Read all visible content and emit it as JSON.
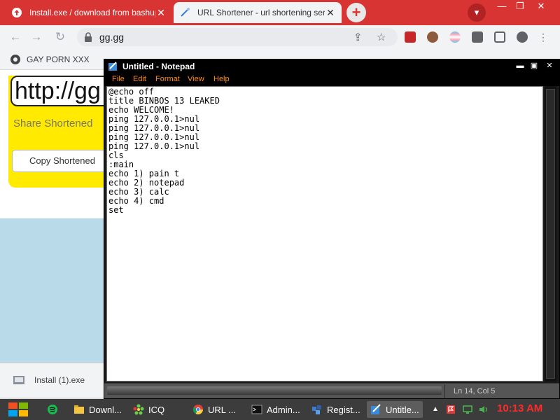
{
  "browser": {
    "tabs": [
      {
        "title": "Install.exe / download from bashupl",
        "icon": "upload-icon",
        "active": false
      },
      {
        "title": "URL Shortener - url shortening serv",
        "icon": "link-icon",
        "active": true
      }
    ],
    "address": "gg.gg",
    "accent_color": "#d83434",
    "bookmarks": [
      {
        "label": "GAY PORN XXX",
        "icon": "puzzle-icon"
      }
    ]
  },
  "webpage": {
    "short_url_value": "http://gg",
    "share_label": "Share Shortened",
    "copy_button": "Copy Shortened",
    "card_color": "#ffea00"
  },
  "download": {
    "filename": "Install (1).exe"
  },
  "notepad": {
    "title": "Untitled - Notepad",
    "menu": [
      "File",
      "Edit",
      "Format",
      "View",
      "Help"
    ],
    "content": "@echo off\ntitle BINBOS 13 LEAKED\necho WELCOME!\nping 127.0.0.1>nul\nping 127.0.0.1>nul\nping 127.0.0.1>nul\nping 127.0.0.1>nul\ncls\n:main\necho 1) pain t\necho 2) notepad\necho 3) calc\necho 4) cmd\nset",
    "status": "Ln 14, Col 5",
    "menu_color": "#ff8c1a"
  },
  "taskbar": {
    "items": [
      {
        "label": "Downl...",
        "icon": "folder-icon"
      },
      {
        "label": "ICQ",
        "icon": "icq-flower-icon"
      },
      {
        "label": "URL ...",
        "icon": "chrome-icon"
      },
      {
        "label": "Admin...",
        "icon": "cmd-icon"
      },
      {
        "label": "Regist...",
        "icon": "registry-icon"
      },
      {
        "label": "Untitle...",
        "icon": "notepad-icon"
      }
    ],
    "clock": "10:13 AM",
    "clock_color": "#ff2a2a"
  }
}
